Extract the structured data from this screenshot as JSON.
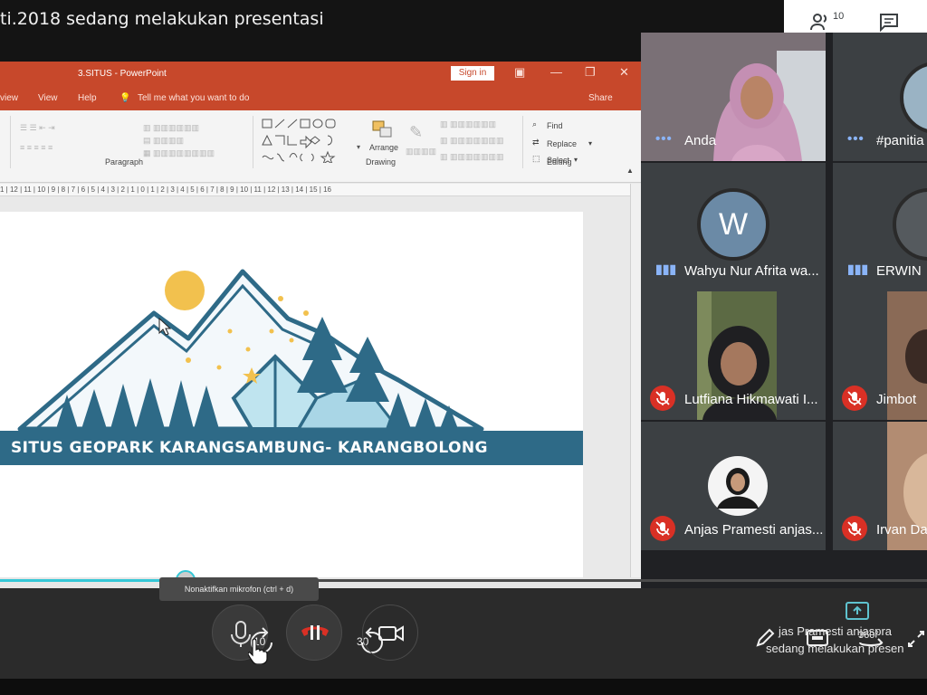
{
  "meeting": {
    "title": "ti.2018 sedang melakukan presentasi"
  },
  "top_actions": {
    "people_count": "10"
  },
  "ppt": {
    "doc_title": "3.SITUS - PowerPoint",
    "sign_in": "Sign in",
    "menu": [
      "view",
      "View",
      "Help",
      "Tell me what you want to do",
      "Share"
    ],
    "ribbon": {
      "paragraph_label": "Paragraph",
      "drawing_label": "Drawing",
      "editing_label": "Editing",
      "arrange": "Arrange",
      "find": "Find",
      "replace": "Replace",
      "select": "Select"
    },
    "ruler": "1 | 12 | 11 | 10 | 9 | 8 | 7 | 6 | 5 | 4 | 3 | 2 | 1 | 0 | 1 | 2 | 3 | 4 | 5 | 6 | 7 | 8 | 9 | 10 | 11 | 12 | 13 | 14 | 15 | 16",
    "slide_banner": "SITUS GEOPARK KARANGSAMBUNG- KARANGBOLONG"
  },
  "participants": [
    {
      "name": "Anda",
      "status": "speaking"
    },
    {
      "name": "#panitia",
      "status": "speaking"
    },
    {
      "name": "Wahyu Nur Afrita wa...",
      "status": "speaking",
      "avatar_letter": "W"
    },
    {
      "name": "ERWIN",
      "status": "speaking"
    },
    {
      "name": "Lutfiana Hikmawati I...",
      "status": "muted"
    },
    {
      "name": "Jimbot",
      "status": "muted"
    },
    {
      "name": "Anjas Pramesti anjas...",
      "status": "muted"
    },
    {
      "name": "Irvan Da",
      "status": "muted"
    }
  ],
  "player": {
    "progress": 0.2,
    "tooltip": "Nonaktifkan mikrofon (ctrl + d)",
    "rewind_label": "10",
    "forward_label": "30",
    "view_label": "360°",
    "present_note_line1": "jas Pramesti anjaspra",
    "present_note_line2": "sedang melakukan presen"
  },
  "colors": {
    "accent": "#35c7d6",
    "ppt": "#c7482b",
    "banner": "#2e6a87",
    "mute": "#d93025",
    "speaking": "#8ab4f8"
  }
}
